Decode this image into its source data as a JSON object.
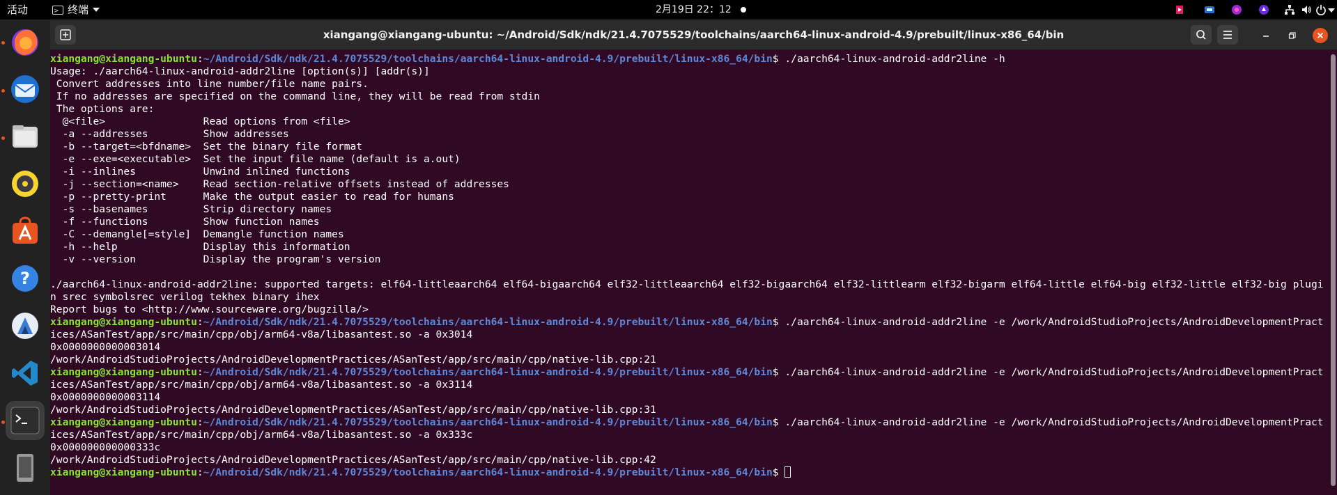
{
  "topbar": {
    "activities": "活动",
    "app_menu": "终端",
    "datetime": "2月19日  22：12"
  },
  "window": {
    "title": "xiangang@xiangang-ubuntu: ~/Android/Sdk/ndk/21.4.7075529/toolchains/aarch64-linux-android-4.9/prebuilt/linux-x86_64/bin"
  },
  "prompt": {
    "user": "xiangang@xiangang-ubuntu",
    "path": "~/Android/Sdk/ndk/21.4.7075529/toolchains/aarch64-linux-android-4.9/prebuilt/linux-x86_64/bin"
  },
  "terminal": {
    "cmd1": "$ ./aarch64-linux-android-addr2line -h",
    "usage": [
      "Usage: ./aarch64-linux-android-addr2line [option(s)] [addr(s)]",
      " Convert addresses into line number/file name pairs.",
      " If no addresses are specified on the command line, they will be read from stdin",
      " The options are:",
      "  @<file>                Read options from <file>",
      "  -a --addresses         Show addresses",
      "  -b --target=<bfdname>  Set the binary file format",
      "  -e --exe=<executable>  Set the input file name (default is a.out)",
      "  -i --inlines           Unwind inlined functions",
      "  -j --section=<name>    Read section-relative offsets instead of addresses",
      "  -p --pretty-print      Make the output easier to read for humans",
      "  -s --basenames         Strip directory names",
      "  -f --functions         Show function names",
      "  -C --demangle[=style]  Demangle function names",
      "  -h --help              Display this information",
      "  -v --version           Display the program's version"
    ],
    "blank": "",
    "targets": "./aarch64-linux-android-addr2line: supported targets: elf64-littleaarch64 elf64-bigaarch64 elf32-littleaarch64 elf32-bigaarch64 elf32-littlearm elf32-bigarm elf64-little elf64-big elf32-little elf32-big plugin srec symbolsrec verilog tekhex binary ihex",
    "bugs": "Report bugs to <http://www.sourceware.org/bugzilla/>",
    "runs": [
      {
        "cmd": "$ ./aarch64-linux-android-addr2line -e /work/AndroidStudioProjects/AndroidDevelopmentPractices/ASanTest/app/src/main/cpp/obj/arm64-v8a/libasantest.so -a 0x3014",
        "addr": "0x0000000000003014",
        "src": "/work/AndroidStudioProjects/AndroidDevelopmentPractices/ASanTest/app/src/main/cpp/native-lib.cpp:21"
      },
      {
        "cmd": "$ ./aarch64-linux-android-addr2line -e /work/AndroidStudioProjects/AndroidDevelopmentPractices/ASanTest/app/src/main/cpp/obj/arm64-v8a/libasantest.so -a 0x3114",
        "addr": "0x0000000000003114",
        "src": "/work/AndroidStudioProjects/AndroidDevelopmentPractices/ASanTest/app/src/main/cpp/native-lib.cpp:31"
      },
      {
        "cmd": "$ ./aarch64-linux-android-addr2line -e /work/AndroidStudioProjects/AndroidDevelopmentPractices/ASanTest/app/src/main/cpp/obj/arm64-v8a/libasantest.so -a 0x333c",
        "addr": "0x000000000000333c",
        "src": "/work/AndroidStudioProjects/AndroidDevelopmentPractices/ASanTest/app/src/main/cpp/native-lib.cpp:42"
      }
    ],
    "final_prompt": "$ "
  },
  "dock": {
    "items": [
      "firefox-icon",
      "thunderbird-icon",
      "files-icon",
      "rhythmbox-icon",
      "software-icon",
      "help-icon",
      "app-icon",
      "vscode-icon",
      "terminal-icon",
      "device-icon"
    ]
  },
  "colors": {
    "terminal_bg": "#300a24",
    "prompt_user": "#8ae234",
    "prompt_path": "#5e88d8",
    "close": "#e95420"
  }
}
